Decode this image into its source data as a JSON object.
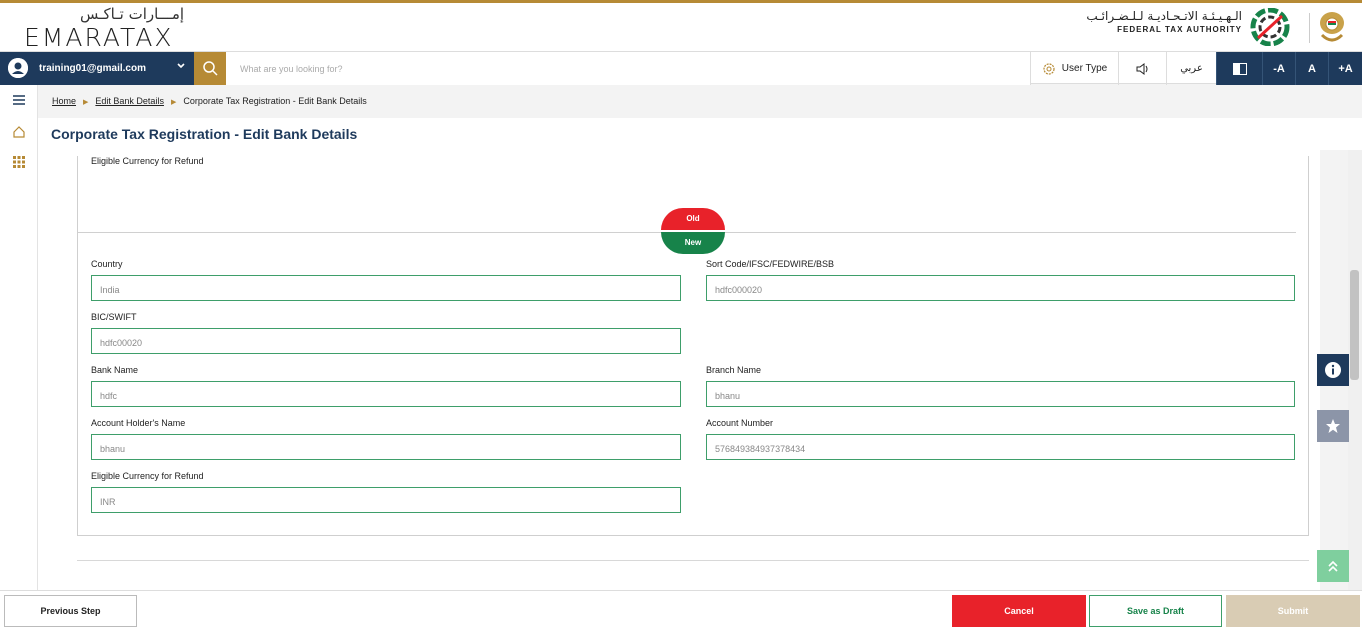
{
  "header": {
    "logo_arabic": "إمـــارات تـاكـس",
    "logo_english": "EMARATAX",
    "fta_arabic": "الـهـيـئـة الاتـحـاديـة لـلـضـرائـب",
    "fta_english": "FEDERAL TAX AUTHORITY"
  },
  "navbar": {
    "user_email": "training01@gmail.com",
    "search_placeholder": "What are you looking for?",
    "user_type_label": "User Type",
    "language_label": "عربي",
    "font_decrease": "-A",
    "font_normal": "A",
    "font_increase": "+A"
  },
  "breadcrumb": {
    "home": "Home",
    "edit_bank": "Edit Bank Details",
    "current": "Corporate Tax Registration - Edit Bank Details"
  },
  "page": {
    "title": "Corporate Tax Registration - Edit Bank Details",
    "top_caption": "Eligible Currency for Refund",
    "old_label": "Old",
    "new_label": "New"
  },
  "form": {
    "country": {
      "label": "Country",
      "value": "India"
    },
    "sort_code": {
      "label": "Sort Code/IFSC/FEDWIRE/BSB",
      "value": "hdfc000020"
    },
    "bic": {
      "label": "BIC/SWIFT",
      "value": "hdfc00020"
    },
    "bank_name": {
      "label": "Bank Name",
      "value": "hdfc"
    },
    "branch_name": {
      "label": "Branch Name",
      "value": "bhanu"
    },
    "holder_name": {
      "label": "Account Holder's Name",
      "value": "bhanu"
    },
    "account_number": {
      "label": "Account Number",
      "value": "576849384937378434"
    },
    "currency": {
      "label": "Eligible Currency for Refund",
      "value": "INR"
    }
  },
  "footer": {
    "previous": "Previous Step",
    "cancel": "Cancel",
    "save_draft": "Save as Draft",
    "submit": "Submit"
  },
  "colors": {
    "navy": "#1e3a5c",
    "gold": "#b68a35",
    "red": "#e8222a",
    "green": "#17834a",
    "teal_border": "#3e9e6a",
    "disabled": "#d9ccb4"
  }
}
